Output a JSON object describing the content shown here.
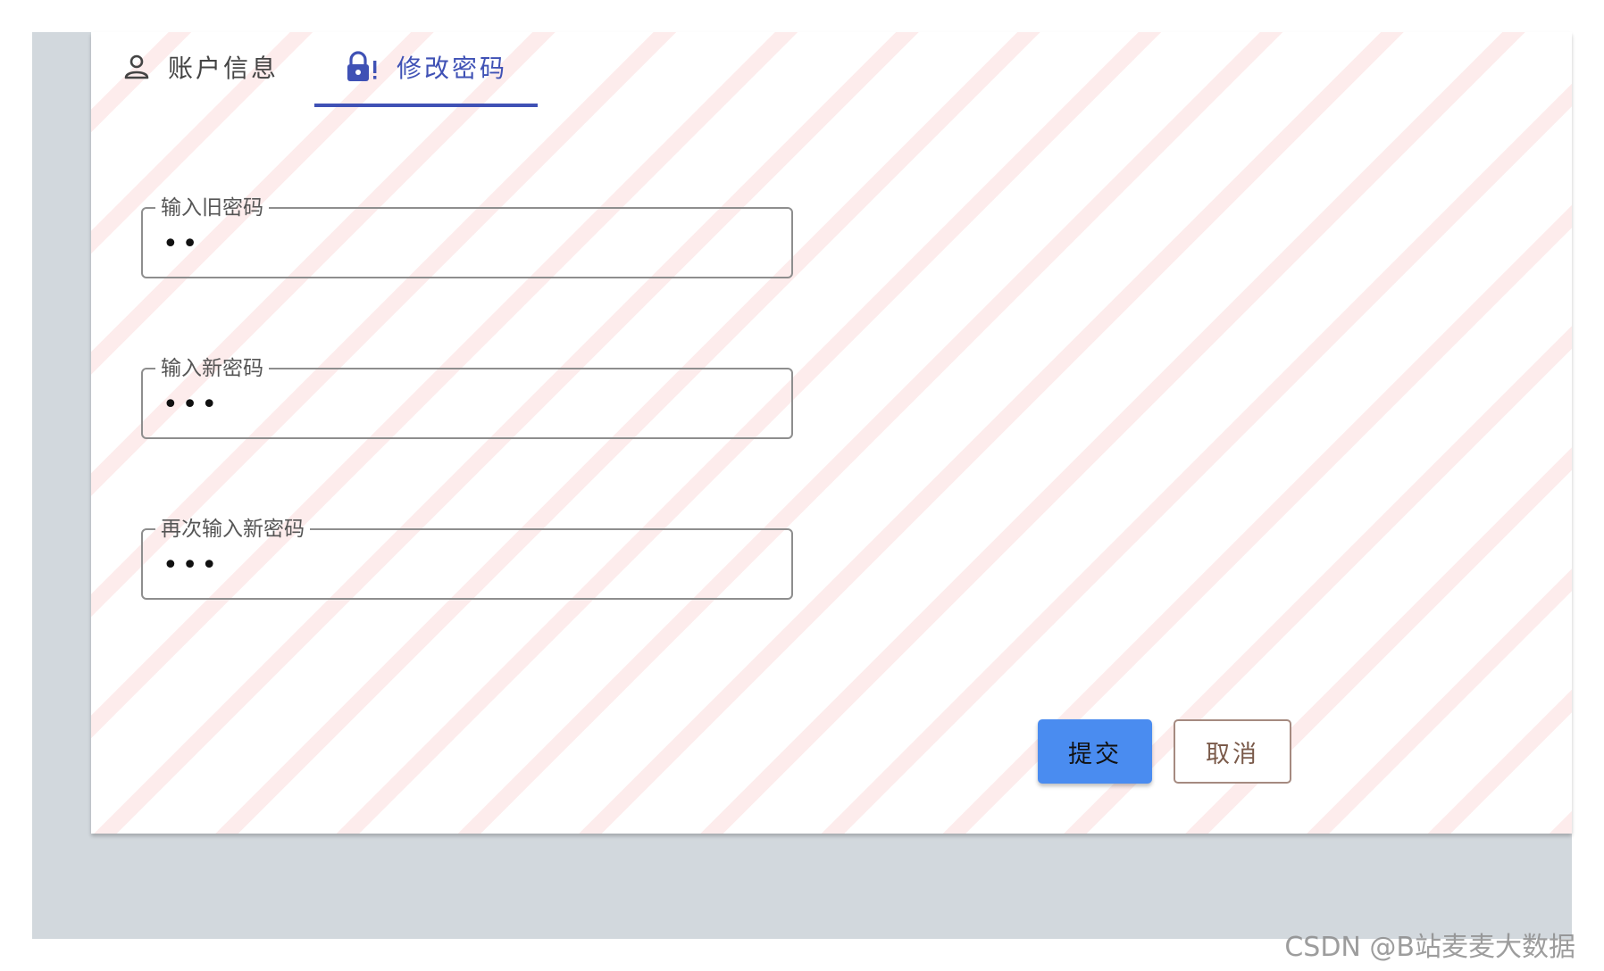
{
  "tabs": {
    "account_label": "账户信息",
    "password_label": "修改密码"
  },
  "form": {
    "old_password": {
      "label": "输入旧密码",
      "value": "••"
    },
    "new_password": {
      "label": "输入新密码",
      "value": "•••"
    },
    "confirm_password": {
      "label": "再次输入新密码",
      "value": "•••"
    }
  },
  "buttons": {
    "submit_label": "提交",
    "cancel_label": "取消"
  },
  "footer": {
    "watermark": "CSDN @B站麦麦大数据"
  },
  "colors": {
    "accent": "#3f51b5",
    "submit": "#4a8cf0",
    "backdrop": "#d2d8dd"
  },
  "icons": {
    "account_tab": "person-outline-icon",
    "password_tab": "lock-alert-icon"
  }
}
